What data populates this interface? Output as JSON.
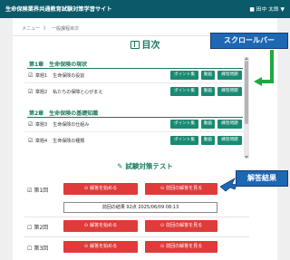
{
  "header": {
    "site_title": "生命保険業界共通教育試験対策学習サイト",
    "user_icon": "user-icon",
    "user_name": "■ 田中 太郎 ▼"
  },
  "breadcrumb": {
    "home": "メニュー",
    "separator": "》",
    "current": "一般課程目次"
  },
  "toc": {
    "title": "目次",
    "chapters": [
      {
        "label": "第1章　生命保険の現状",
        "sections": [
          {
            "check": "☑",
            "num": "章題1",
            "title": "生命保険の役割",
            "buttons": [
              "ポイント集",
              "動画",
              "練習問題"
            ]
          },
          {
            "check": "☑",
            "num": "章題2",
            "title": "私たちの保障と心がまえ",
            "buttons": [
              "ポイント集",
              "動画",
              "練習問題"
            ]
          }
        ]
      },
      {
        "label": "第2章　生命保険の基礎知識",
        "sections": [
          {
            "check": "☑",
            "num": "章題3",
            "title": "生命保険の仕組み",
            "buttons": [
              "ポイント集",
              "動画",
              "練習問題"
            ]
          },
          {
            "check": "☑",
            "num": "章題4",
            "title": "生命保険の種類",
            "buttons": [
              "ポイント集",
              "動画",
              "練習問題"
            ]
          }
        ]
      }
    ]
  },
  "test": {
    "title": "試験対策テスト",
    "rounds": [
      {
        "check": "☑",
        "label": "第1回",
        "start": "解答を始める",
        "review": "前回の解答を見る"
      },
      {
        "check": "☐",
        "label": "第2回",
        "start": "解答を始める",
        "review": "前回の解答を見る"
      },
      {
        "check": "☐",
        "label": "第3回",
        "start": "解答を始める",
        "review": "前回の解答を見る"
      }
    ],
    "result": "前回の結果 92点 2025/06/09 08:13"
  },
  "callouts": {
    "scrollbar": "スクロールバー",
    "result": "解答結果"
  },
  "colors": {
    "header": "#0b5a6a",
    "green": "#1a8a72",
    "red": "#e03a3a",
    "callout": "#1e67b3",
    "arrow": "#1da83f"
  }
}
